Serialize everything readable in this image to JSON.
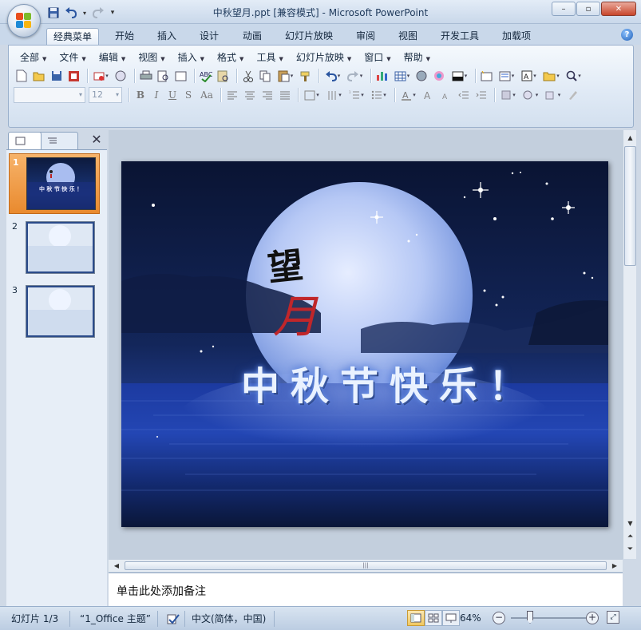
{
  "window": {
    "title": "中秋望月.ppt [兼容模式] - Microsoft PowerPoint",
    "minimize_glyph": "–",
    "maximize_glyph": "▫",
    "close_glyph": "✕"
  },
  "ribbon_tabs": [
    "经典菜单",
    "开始",
    "插入",
    "设计",
    "动画",
    "幻灯片放映",
    "审阅",
    "视图",
    "开发工具",
    "加载项"
  ],
  "active_tab": "经典菜单",
  "help_glyph": "?",
  "menu": [
    "全部",
    "文件",
    "编辑",
    "视图",
    "插入",
    "格式",
    "工具",
    "幻灯片放映",
    "窗口",
    "帮助"
  ],
  "format_bar": {
    "font_name": "",
    "font_size": "12",
    "bold": "B",
    "italic": "I",
    "underline": "U",
    "shadow": "S",
    "case": "Aa"
  },
  "thumbnails": [
    {
      "number": "1",
      "title": "中秋节快乐！"
    },
    {
      "number": "2",
      "title": ""
    },
    {
      "number": "3",
      "title": ""
    }
  ],
  "slide": {
    "vertical_title_1": "望",
    "vertical_title_2": "月",
    "greeting": "中秋节快乐！",
    "colors": {
      "sky": "#0e1a3d",
      "moon": "#b9caf5",
      "sea": "#1a2f7a",
      "title_red": "#c0262a"
    }
  },
  "notes": {
    "placeholder": "单击此处添加备注"
  },
  "status": {
    "slide_info": "幻灯片 1/3",
    "theme": "“1_Office 主题”",
    "language": "中文(简体，中国)",
    "zoom": "64%",
    "zoom_out": "−",
    "zoom_in": "+"
  },
  "icons": {
    "office_button": "office-logo-icon",
    "qat": [
      "save-icon",
      "undo-icon",
      "redo-icon",
      "customize-qat-icon"
    ]
  }
}
